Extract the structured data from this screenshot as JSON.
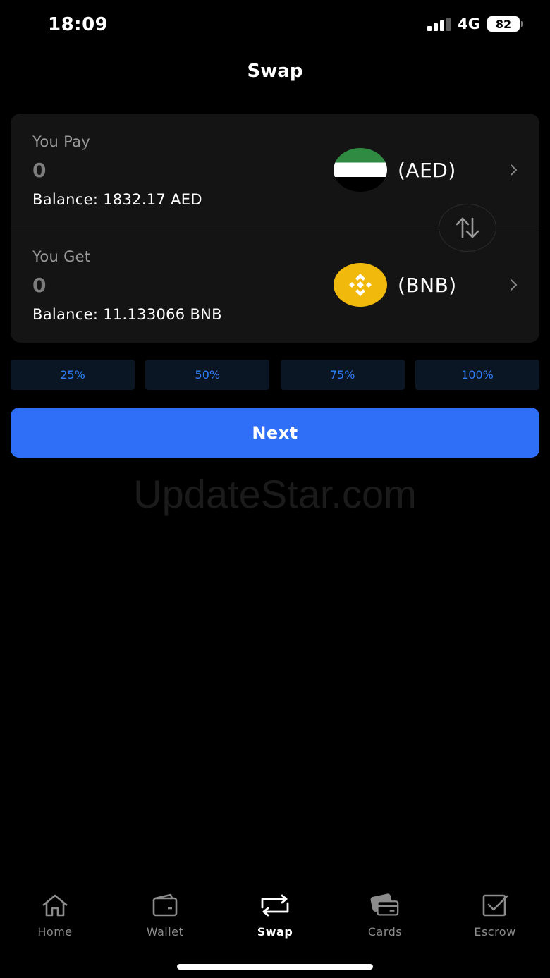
{
  "status_bar": {
    "time": "18:09",
    "network": "4G",
    "battery": "82"
  },
  "header": {
    "title": "Swap"
  },
  "pay": {
    "label": "You Pay",
    "amount": "0",
    "balance": "Balance: 1832.17 AED",
    "token": "(AED)",
    "token_icon": "uae-flag-icon"
  },
  "get": {
    "label": "You Get",
    "amount": "0",
    "balance": "Balance: 11.133066 BNB",
    "token": "(BNB)",
    "token_icon": "bnb-logo-icon"
  },
  "percent_options": [
    "25%",
    "50%",
    "75%",
    "100%"
  ],
  "next_label": "Next",
  "watermark": "UpdateStar.com",
  "tabs": [
    {
      "label": "Home",
      "icon": "home-icon",
      "active": false
    },
    {
      "label": "Wallet",
      "icon": "wallet-icon",
      "active": false
    },
    {
      "label": "Swap",
      "icon": "swap-icon",
      "active": true
    },
    {
      "label": "Cards",
      "icon": "cards-icon",
      "active": false
    },
    {
      "label": "Escrow",
      "icon": "escrow-icon",
      "active": false
    }
  ],
  "colors": {
    "background": "#000000",
    "card": "#141414",
    "accent": "#2f6ff7",
    "percent_text": "#2e7cf6",
    "muted": "#8c8c8c",
    "bnb": "#f0b90b",
    "flag_green": "#2f8a42"
  }
}
